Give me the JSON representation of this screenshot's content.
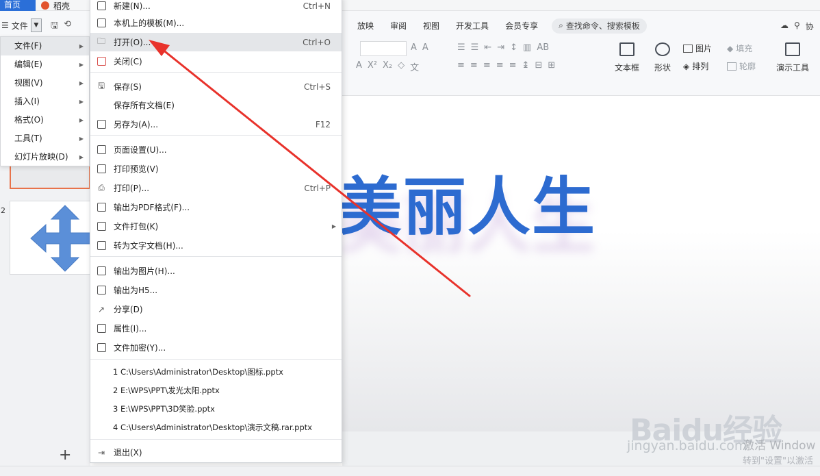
{
  "titlebar": {
    "home_tab": "首页",
    "doc_tab": "稻壳"
  },
  "toolbar": {
    "file_menu": "文件",
    "ribbon_tabs": [
      "放映",
      "审阅",
      "视图",
      "开发工具",
      "会员专享"
    ],
    "search_placeholder": "查找命令、搜索模板",
    "right_partial": "协",
    "buttons": {
      "textbox": "文本框",
      "shape": "形状",
      "image": "图片",
      "arrange": "排列",
      "fill": "填充",
      "outline": "轮廓",
      "presenter_tools": "演示工具"
    }
  },
  "submenu": {
    "items": [
      {
        "label": "文件(F)",
        "active": true
      },
      {
        "label": "编辑(E)"
      },
      {
        "label": "视图(V)"
      },
      {
        "label": "插入(I)"
      },
      {
        "label": "格式(O)"
      },
      {
        "label": "工具(T)"
      },
      {
        "label": "幻灯片放映(D)"
      }
    ]
  },
  "dropdown": {
    "new": {
      "label": "新建(N)...",
      "shortcut": "Ctrl+N"
    },
    "local_template": {
      "label": "本机上的模板(M)..."
    },
    "open": {
      "label": "打开(O)...",
      "shortcut": "Ctrl+O"
    },
    "close": {
      "label": "关闭(C)"
    },
    "save": {
      "label": "保存(S)",
      "shortcut": "Ctrl+S"
    },
    "save_all": {
      "label": "保存所有文档(E)"
    },
    "save_as": {
      "label": "另存为(A)...",
      "shortcut": "F12"
    },
    "page_setup": {
      "label": "页面设置(U)..."
    },
    "print_preview": {
      "label": "打印预览(V)"
    },
    "print": {
      "label": "打印(P)...",
      "shortcut": "Ctrl+P"
    },
    "export_pdf": {
      "label": "输出为PDF格式(F)..."
    },
    "package": {
      "label": "文件打包(K)"
    },
    "to_text": {
      "label": "转为文字文档(H)..."
    },
    "export_image": {
      "label": "输出为图片(H)..."
    },
    "export_h5": {
      "label": "输出为H5..."
    },
    "share": {
      "label": "分享(D)"
    },
    "properties": {
      "label": "属性(I)..."
    },
    "encrypt": {
      "label": "文件加密(Y)..."
    },
    "recent_files": [
      "1 C:\\Users\\Administrator\\Desktop\\图标.pptx",
      "2 E:\\WPS\\PPT\\发光太阳.pptx",
      "3 E:\\WPS\\PPT\\3D笑脸.pptx",
      "4 C:\\Users\\Administrator\\Desktop\\演示文稿.rar.pptx"
    ],
    "exit": {
      "label": "退出(X)"
    }
  },
  "slides": {
    "slide2_number": "2"
  },
  "canvas": {
    "title_text": "美丽人生"
  },
  "watermark": {
    "logo": "Baidu经验",
    "url": "jingyan.baidu.com"
  },
  "activation": {
    "line1": "激活 Window",
    "line2": "转到\"设置\"以激活"
  },
  "colors": {
    "accent": "#2b6fd8",
    "arrow": "#e8322b",
    "title_blue": "#2d6bd0"
  }
}
